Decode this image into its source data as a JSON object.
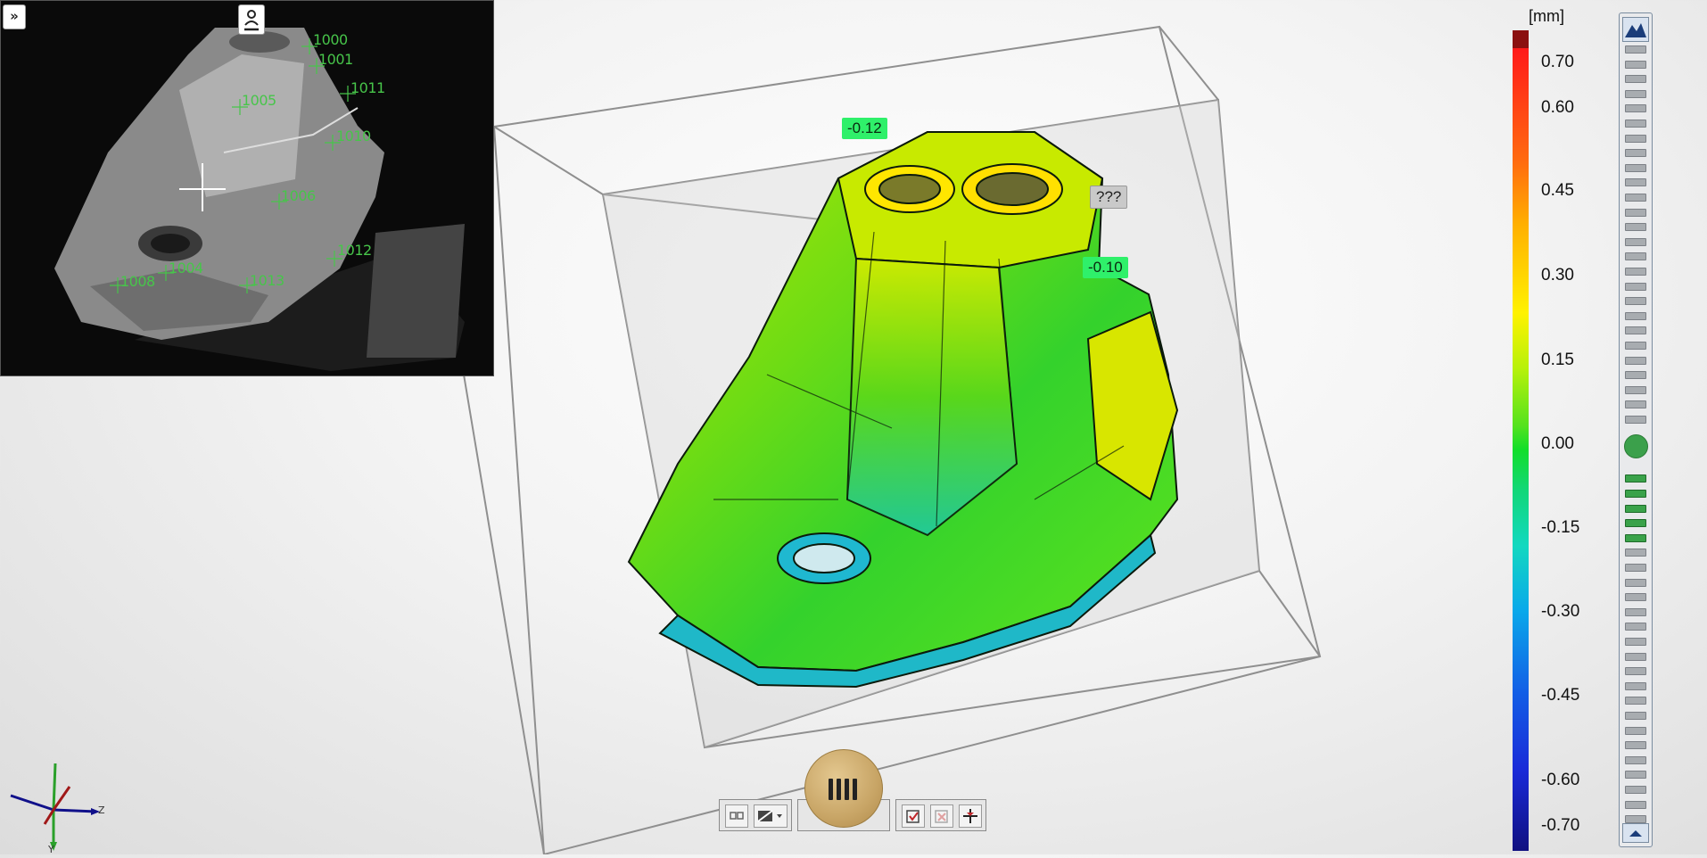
{
  "camera": {
    "expand_label": "»",
    "points": [
      {
        "id": "1000",
        "label": "1000"
      },
      {
        "id": "1001",
        "label": "1001"
      },
      {
        "id": "1011",
        "label": "1011"
      },
      {
        "id": "1005",
        "label": "1005"
      },
      {
        "id": "1010",
        "label": "1010"
      },
      {
        "id": "1006",
        "label": "1006"
      },
      {
        "id": "1012",
        "label": "1012"
      },
      {
        "id": "1004",
        "label": "1004"
      },
      {
        "id": "1008",
        "label": "1008"
      },
      {
        "id": "1013",
        "label": "1013"
      }
    ]
  },
  "callouts": {
    "a": "-0.12",
    "b": "???",
    "c": "-0.10"
  },
  "legend": {
    "unit": "[mm]",
    "ticks": [
      "0.70",
      "0.60",
      "0.45",
      "0.30",
      "0.15",
      "0.00",
      "-0.15",
      "-0.30",
      "-0.45",
      "-0.60",
      "-0.70"
    ],
    "top_color": "#8b1010",
    "bottom_color": "#101080"
  },
  "slider": {
    "active_level_fraction": 0.52
  },
  "axes": {
    "z": "Z",
    "y": "Y"
  },
  "colors": {
    "accent_green": "#2ff06a",
    "point_green": "#47c54a"
  }
}
